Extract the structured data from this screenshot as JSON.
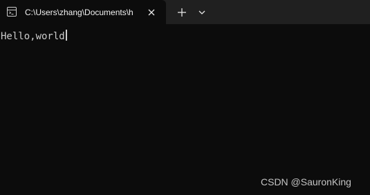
{
  "tab": {
    "title": "C:\\Users\\zhang\\Documents\\h",
    "icon": "terminal-icon"
  },
  "tabbar": {
    "close_icon": "close-icon",
    "new_tab_icon": "plus-icon",
    "dropdown_icon": "chevron-down-icon"
  },
  "terminal": {
    "output": "Hello,world"
  },
  "watermark": "CSDN @SauronKing",
  "colors": {
    "tabbar_bg": "#202020",
    "terminal_bg": "#0c0c0c",
    "text": "#cccccc"
  }
}
